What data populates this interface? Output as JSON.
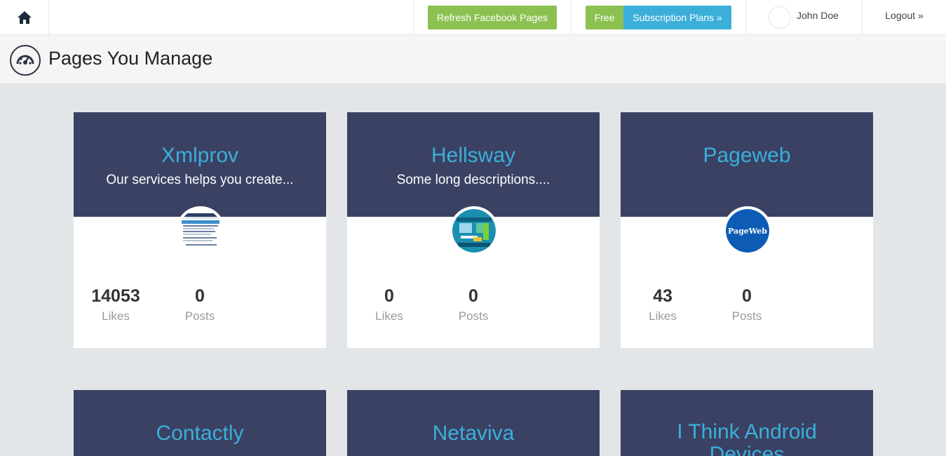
{
  "nav": {
    "refresh_label": "Refresh Facebook Pages",
    "free_label": "Free",
    "plans_label": "Subscription Plans »",
    "user_name": "John Doe",
    "logout_label": "Logout »",
    "home_icon": "home-icon"
  },
  "header": {
    "title": "Pages You Manage",
    "icon": "dashboard-icon"
  },
  "colors": {
    "green": "#8cc152",
    "blue": "#3bafda",
    "card_header": "#3a4163",
    "background": "#e3e6e9"
  },
  "cards": [
    {
      "name": "Xmlprov",
      "description": "Our services helps you create...",
      "likes": "14053",
      "likes_label": "Likes",
      "posts": "0",
      "posts_label": "Posts"
    },
    {
      "name": "Hellsway",
      "description": "Some long descriptions....",
      "likes": "0",
      "likes_label": "Likes",
      "posts": "0",
      "posts_label": "Posts"
    },
    {
      "name": "Pageweb",
      "description": "",
      "likes": "43",
      "likes_label": "Likes",
      "posts": "0",
      "posts_label": "Posts",
      "logo_text": "PageWeb"
    },
    {
      "name": "Contactly"
    },
    {
      "name": "Netaviva"
    },
    {
      "name": "I Think Android Devices"
    }
  ]
}
